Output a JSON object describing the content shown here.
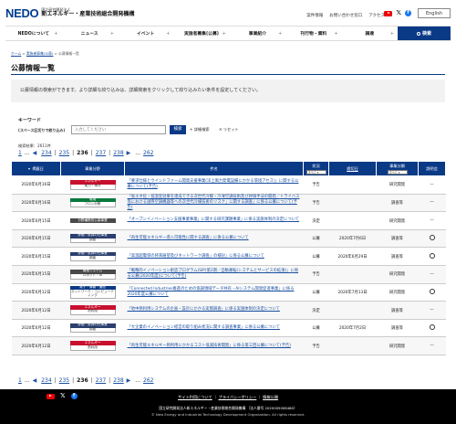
{
  "header": {
    "logo_mark": "NEDO",
    "logo_sub": "国立研究開発法人",
    "logo_main": "新エネルギー・産業技術総合開発機構",
    "links": [
      "案件情報",
      "お問い合わせ窓口",
      "アクセス"
    ],
    "english": "English"
  },
  "nav": {
    "items": [
      "NEDOについて",
      "ニュース",
      "イベント",
      "実施者募集(公募)",
      "事業紹介",
      "刊行物・資料",
      "調達"
    ],
    "search": "検索"
  },
  "breadcrumb": [
    "ホーム",
    "実施者募集(公募)",
    "公募情報一覧"
  ],
  "page_title": "公募情報一覧",
  "intro": "公募情報の検索ができます。より詳細な絞り込みは、詳細検索をクリックして絞り込みたい条件を設定してください。",
  "keyword": {
    "label": "キーワード",
    "sub": "(スペース区切りで絞り込み)",
    "placeholder": "入力してください",
    "search_btn": "検索",
    "detail": "+ 詳細検索",
    "reset": "✕ リセット"
  },
  "count": "検索結果：2611件",
  "pager": {
    "first": "1",
    "ellipsis": "...",
    "prev_pages": [
      "234",
      "235"
    ],
    "current": "236",
    "next_pages": [
      "237",
      "238"
    ],
    "last": "262"
  },
  "table": {
    "headers": {
      "date": "掲載日",
      "dept": "事業分野",
      "title": "件名",
      "status": "状況",
      "deadline": "締切日",
      "type": "事業分類",
      "explain": "説明会"
    },
    "selects": {
      "status": "すべて",
      "type": "すべて"
    },
    "rows": [
      {
        "date": "2020年6月16日",
        "cat_top": "エネルギー",
        "cat_bot": "風力・海洋",
        "color": "red",
        "title": "「要求仕様とウインドファーム開発支援事業(洋上風力発電設備にかかる環境アセス)」に関する公募について(予告)",
        "status": "予告",
        "deadline": "",
        "type": "研究開発",
        "explain": "—"
      },
      {
        "date": "2020年6月16日",
        "cat_top": "環境",
        "cat_bot": "フロン対策",
        "color": "green",
        "title": "「省エネ化・低温室効果を達成できる次世代冷媒・冷凍空調技術及び評価手法の開発／トライバス等における国際空調機器等への次世代冷媒技術のリスク」に関する調査」に係る公募について(予告)",
        "status": "予告",
        "deadline": "",
        "type": "調査等",
        "explain": "—"
      },
      {
        "date": "2020年6月15日",
        "cat_top": "分野横断的公募事業",
        "cat_bot": "",
        "color": "gray",
        "title": "「オープンイノベーション支援事業事業」に関する研究課題事業」に係る実施体制の決定について",
        "status": "決定",
        "deadline": "",
        "type": "研究開発",
        "explain": "—"
      },
      {
        "date": "2020年6月15日",
        "cat_top": "評価・試算の仕事業",
        "cat_bot": "調査",
        "color": "navy",
        "title": "「再生可能エネルギー導入可能性に関する調査」に係る公募について",
        "status": "公募",
        "deadline": "2020年7月6日",
        "type": "調査等",
        "explain": "○"
      },
      {
        "date": "2020年6月15日",
        "cat_top": "評価・試算の仕事業",
        "cat_bot": "調査",
        "color": "navy",
        "title": "「高温超電導の将来展望及びネットワーク調査」の検討」に係る公募について",
        "status": "公募",
        "deadline": "2020年6月29日",
        "type": "調査等",
        "explain": "○"
      },
      {
        "date": "2020年6月15日",
        "cat_top": "機械システム",
        "cat_bot": "ロボット・AI",
        "color": "gray",
        "title": "「戦略的イノベーション創造プログラム(SIP)第2期／自動運転(システムとサービスの拡張)」に係る公募(2020年度)について(予告)",
        "status": "予告",
        "deadline": "",
        "type": "研究開発",
        "explain": "—"
      },
      {
        "date": "2020年6月12日",
        "cat_top": "電子・情報・通信",
        "cat_bot": "ネットワーク・コンピューティング",
        "color": "blue",
        "title": "「Connected Industries推進のための協調領域データ共有・AIシステム開発促進事業」に係る2020年度公募について",
        "status": "公募",
        "deadline": "2020年7月13日",
        "type": "研究開発",
        "explain": "○"
      },
      {
        "date": "2020年6月12日",
        "cat_top": "エネルギー",
        "cat_bot": "熱利用",
        "color": "red",
        "title": "「地中熱利用システムの企画・設計にかかる実態調査」に係る実施体制の決定について",
        "status": "決定",
        "deadline": "",
        "type": "調査等",
        "explain": "—"
      },
      {
        "date": "2020年6月12日",
        "cat_top": "評価・試算の仕事業",
        "cat_bot": "調査",
        "color": "navy",
        "title": "「大企業のイノベーション経営の取り組み状況に関する調査事業」に係る公募について",
        "status": "公募",
        "deadline": "2020年7月2日",
        "type": "調査等",
        "explain": "○"
      },
      {
        "date": "2020年6月12日",
        "cat_top": "エネルギー",
        "cat_bot": "熱利用",
        "color": "red",
        "title": "「再生可能エネルギー熱利用にかかるコスト低減技術開発」に係る第三回公募について(予告)",
        "status": "予告",
        "deadline": "",
        "type": "研究開発",
        "explain": "—"
      }
    ]
  },
  "footer": {
    "links": [
      "サイト利用について",
      "プライバシーポリシー",
      "情報公開"
    ],
    "org": "国立研究開発法人新エネルギー・産業技術総合開発機構 （法人番号 2020005008480）",
    "copy": "© New Energy and Industrial Technology Development Organization. All rights reserved."
  }
}
